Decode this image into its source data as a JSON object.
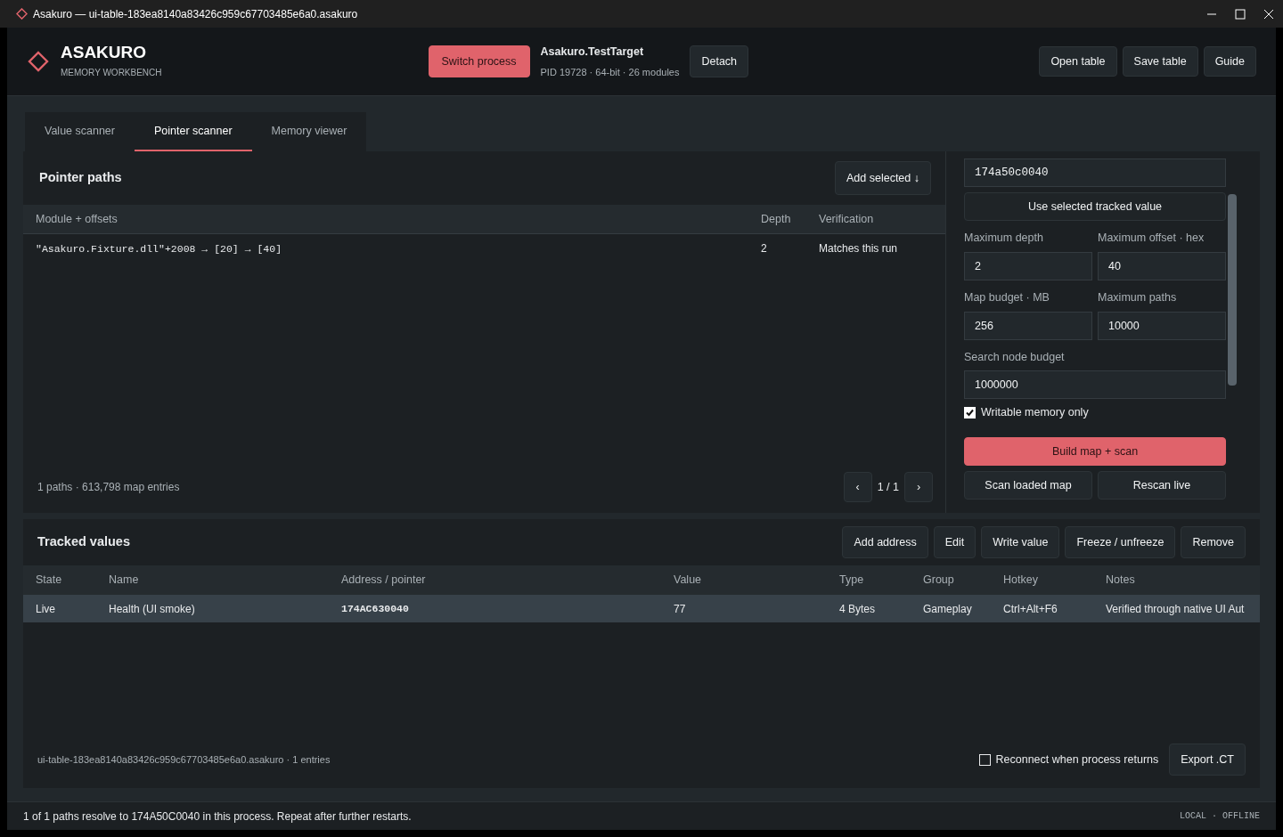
{
  "window": {
    "title": "Asakuro — ui-table-183ea8140a83426c959c67703485e6a0.asakuro"
  },
  "header": {
    "app_name": "ASAKURO",
    "subtitle": "MEMORY WORKBENCH",
    "switch_button": "Switch process",
    "process": {
      "name": "Asakuro.TestTarget",
      "details": "PID 19728 · 64-bit · 26 modules"
    },
    "detach_button": "Detach",
    "actions": [
      "Open table",
      "Save table",
      "Guide"
    ]
  },
  "tabs": [
    {
      "label": "Value scanner",
      "selected": false
    },
    {
      "label": "Pointer scanner",
      "selected": true
    },
    {
      "label": "Memory viewer",
      "selected": false
    }
  ],
  "pointer_paths": {
    "title": "Pointer paths",
    "add_button": "Add selected ↓",
    "columns": [
      "Module + offsets",
      "Depth",
      "Verification"
    ],
    "rows": [
      {
        "path": "\"Asakuro.Fixture.dll\"+2008 → [20] → [40]",
        "depth": "2",
        "verification": "Matches this run"
      }
    ],
    "summary": "1 paths · 613,798 map entries",
    "prev": "‹",
    "page": "1 / 1",
    "next": "›"
  },
  "scan_settings": {
    "address": "174a50c0040",
    "use_button": "Use selected tracked value",
    "field_rows": [
      [
        {
          "label": "Maximum depth",
          "value": "2"
        },
        {
          "label": "Maximum offset · hex",
          "value": "40"
        }
      ],
      [
        {
          "label": "Map budget · MB",
          "value": "256"
        },
        {
          "label": "Maximum paths",
          "value": "10000"
        }
      ],
      [
        {
          "label": "Search node budget",
          "value": "1000000"
        }
      ]
    ],
    "writable": {
      "label": "Writable memory only",
      "checked": true
    },
    "build_button": "Build map + scan",
    "scan_buttons": [
      "Scan loaded map",
      "Rescan live"
    ]
  },
  "tracked": {
    "title": "Tracked values",
    "buttons": [
      "Add address",
      "Edit",
      "Write value",
      "Freeze / unfreeze",
      "Remove"
    ],
    "columns": [
      "State",
      "Name",
      "Address / pointer",
      "Value",
      "Type",
      "Group",
      "Hotkey",
      "Notes"
    ],
    "rows": [
      {
        "state": "Live",
        "name": "Health (UI smoke)",
        "address": "174AC630040",
        "value": "77",
        "type": "4 Bytes",
        "group": "Gameplay",
        "hotkey": "Ctrl+Alt+F6",
        "notes": "Verified through native UI Aut",
        "selected": true
      }
    ],
    "footer": "ui-table-183ea8140a83426c959c67703485e6a0.asakuro · 1 entries",
    "reconnect": {
      "label": "Reconnect when process returns",
      "checked": false
    },
    "export_button": "Export .CT"
  },
  "status_bar": {
    "message": "1 of 1 paths resolve to 174A50C0040 in this process. Repeat after further restarts.",
    "indicator": "LOCAL · OFFLINE"
  }
}
